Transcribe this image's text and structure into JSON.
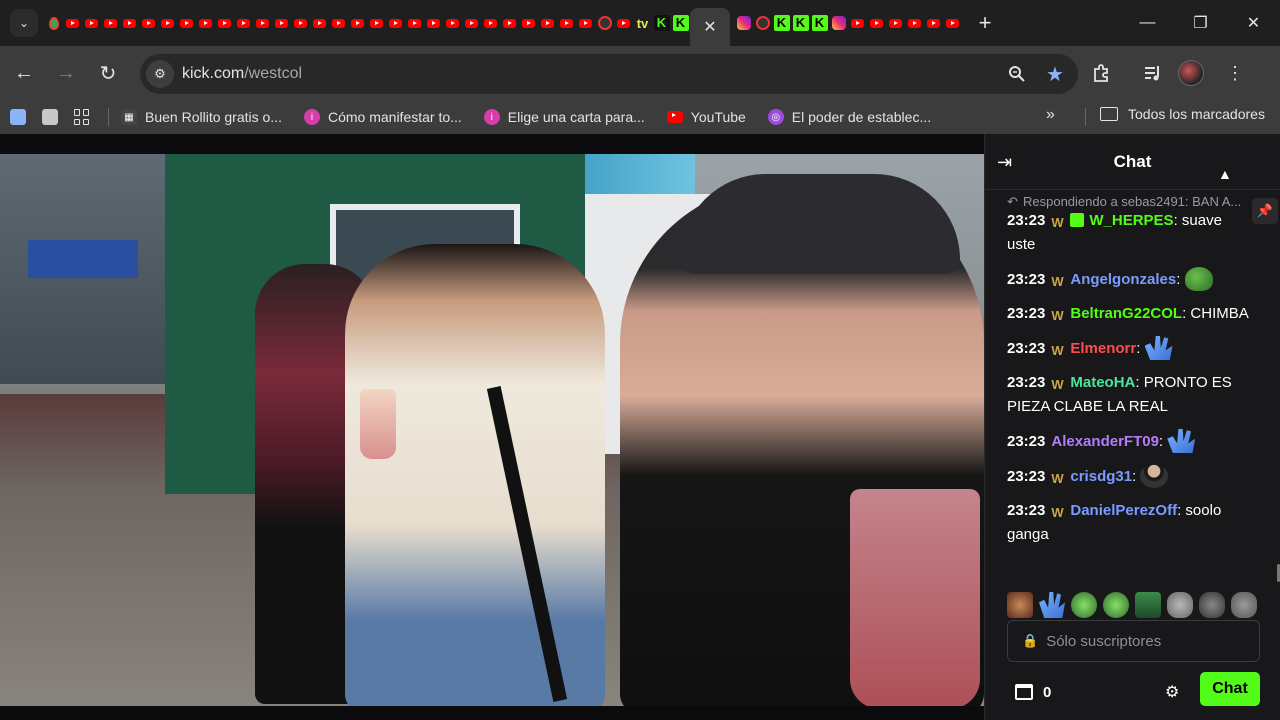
{
  "browser": {
    "active_tab_close": "✕",
    "new_tab": "+",
    "window": {
      "minimize": "—",
      "restore": "❐",
      "close": "✕"
    }
  },
  "toolbar": {
    "url_host": "kick.com",
    "url_path": "/westcol"
  },
  "bookmarks": {
    "items": [
      {
        "label": "Buen Rollito gratis o..."
      },
      {
        "label": "Cómo manifestar to..."
      },
      {
        "label": "Elige una carta para..."
      },
      {
        "label": "YouTube"
      },
      {
        "label": "El poder de establec..."
      }
    ],
    "more": "»",
    "all_bookmarks": "Todos los marcadores"
  },
  "chat": {
    "title": "Chat",
    "reply_preview": "Respondiendo a sebas2491: BAN A...",
    "messages": [
      {
        "time": "23:23",
        "user": "W_HERPES",
        "user_color": "#53fc18",
        "text": "suave uste"
      },
      {
        "time": "23:23",
        "user": "Angelgonzales",
        "user_color": "#7b9bff",
        "text": ""
      },
      {
        "time": "23:23",
        "user": "BeltranG22COL",
        "user_color": "#53fc18",
        "text": "CHIMBA"
      },
      {
        "time": "23:23",
        "user": "Elmenorr",
        "user_color": "#ff4d4d",
        "text": ""
      },
      {
        "time": "23:23",
        "user": "MateoHA",
        "user_color": "#4ee39a",
        "text": "PRONTO ES PIEZA CLABE LA REAL"
      },
      {
        "time": "23:23",
        "user": "AlexanderFT09",
        "user_color": "#b57bff",
        "text": ""
      },
      {
        "time": "23:23",
        "user": "crisdg31",
        "user_color": "#7b9bff",
        "text": ""
      },
      {
        "time": "23:23",
        "user": "DanielPerezOff",
        "user_color": "#7b9bff",
        "text": "soolo ganga"
      }
    ],
    "input_placeholder": "Sólo suscriptores",
    "points": "0",
    "send_label": "Chat"
  },
  "colors": {
    "kick_green": "#53fc18",
    "chat_bg": "#18181b",
    "browser_toolbar": "#3c3c3c"
  }
}
